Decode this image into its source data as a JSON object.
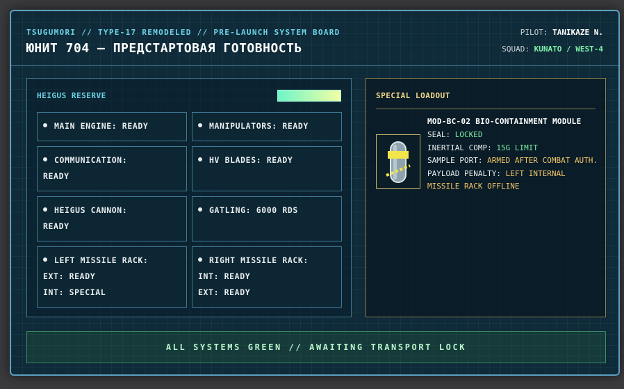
{
  "header": {
    "subtitle": "TSUGUMORI // TYPE-17 REMODELED // PRE-LAUNCH SYSTEM BOARD",
    "title": "ЮНИТ 704 — ПРЕДСТАРТОВАЯ ГОТОВНОСТЬ",
    "pilot_label": "PILOT:",
    "pilot_value": "TANIKAZE N.",
    "squad_label": "SQUAD:",
    "squad_value": "KUNATO / WEST-4"
  },
  "reserve": {
    "title": "HEIGUS RESERVE",
    "level": 1.0,
    "cells": [
      {
        "lines": [
          "MAIN ENGINE: READY"
        ]
      },
      {
        "lines": [
          "MANIPULATORS: READY"
        ]
      },
      {
        "lines": [
          "COMMUNICATION:",
          "READY"
        ]
      },
      {
        "lines": [
          "HV BLADES: READY"
        ]
      },
      {
        "lines": [
          "HEIGUS CANNON:",
          "READY"
        ]
      },
      {
        "lines": [
          "GATLING: 6000 RDS"
        ]
      },
      {
        "lines": [
          "LEFT MISSILE RACK:",
          "EXT: READY",
          "INT: SPECIAL"
        ]
      },
      {
        "lines": [
          "RIGHT MISSILE RACK:",
          "INT: READY",
          "EXT: READY"
        ]
      }
    ]
  },
  "loadout": {
    "title": "SPECIAL LOADOUT",
    "module_name": "MOD-BC-02 BIO-CONTAINMENT MODULE",
    "seal_label": "SEAL:",
    "seal_value": "LOCKED",
    "inertial_label": "INERTIAL COMP:",
    "inertial_value": "15G LIMIT",
    "sample_label": "SAMPLE PORT:",
    "sample_value": "ARMED AFTER COMBAT AUTH.",
    "penalty_label": "PAYLOAD PENALTY:",
    "penalty_value": "LEFT INTERNAL MISSILE RACK OFFLINE",
    "icon": "bio-canister-icon"
  },
  "status": {
    "text": "ALL SYSTEMS GREEN // AWAITING TRANSPORT LOCK"
  },
  "colors": {
    "accent_cyan": "#6cd3e8",
    "accent_green": "#7ef0a8",
    "accent_gold": "#f4c56a",
    "panel_bg": "#0f2a38"
  }
}
